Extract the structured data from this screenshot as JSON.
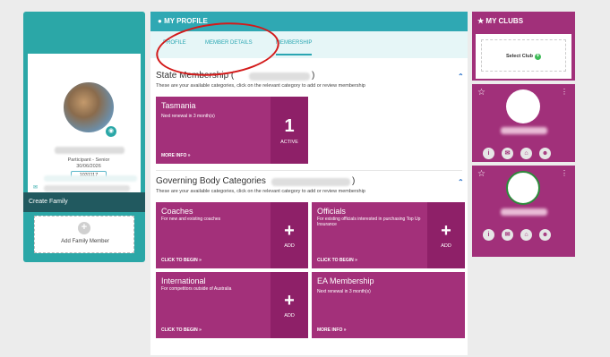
{
  "profile": {
    "role": "Participant - Senior",
    "date": "30/06/2026",
    "member_id": "1031117",
    "create_family_label": "Create Family",
    "add_family_member_label": "Add Family Member"
  },
  "main": {
    "header_title": "MY PROFILE",
    "tabs": [
      {
        "label": "PROFILE"
      },
      {
        "label": "MEMBER DETAILS"
      },
      {
        "label": "MEMBERSHIP"
      }
    ],
    "state_section": {
      "title_prefix": "State Membership (",
      "title_suffix": ")",
      "subtitle": "These are your available categories, click on the relevant category to add or review membership"
    },
    "governing_section": {
      "title_prefix": "Governing Body Categories",
      "title_suffix": ")",
      "subtitle": "These are your available categories, click on the relevant category to add or review membership"
    },
    "cards": {
      "tasmania": {
        "title": "Tasmania",
        "desc": "Next renewal in 3 month(s)",
        "link": "MORE INFO »",
        "side_value": "1",
        "side_label": "ACTIVE"
      },
      "coaches": {
        "title": "Coaches",
        "desc": "For new and existing coaches",
        "link": "CLICK TO BEGIN »",
        "side_label": "ADD"
      },
      "officials": {
        "title": "Officials",
        "desc": "For existing officials interested in purchasing Top Up Insurance",
        "link": "CLICK TO BEGIN »",
        "side_label": "ADD"
      },
      "international": {
        "title": "International",
        "desc": "For competitors outside of Australia",
        "link": "CLICK TO BEGIN »",
        "side_label": "ADD"
      },
      "ea": {
        "title": "EA Membership",
        "desc": "Next renewal in 3 month(s)",
        "link": "MORE INFO »"
      }
    }
  },
  "clubs": {
    "header_title": "MY CLUBS",
    "select_club_label": "Select Club"
  },
  "colors": {
    "teal": "#2ba7a7",
    "magenta": "#a3307a",
    "annotation": "#d31a1a"
  }
}
